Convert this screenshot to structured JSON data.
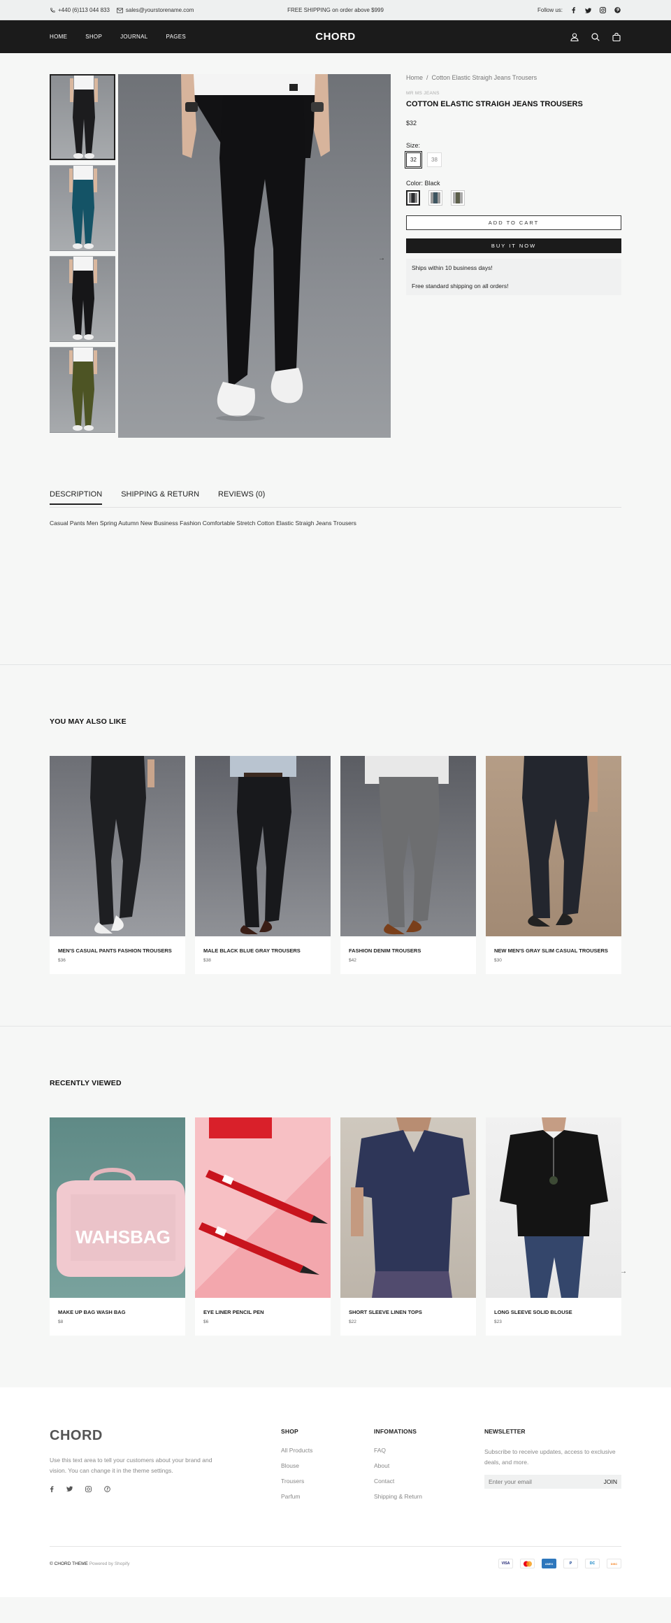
{
  "topbar": {
    "phone": "+440 (6)113 044 833",
    "email": "sales@yourstorename.com",
    "promo": "FREE SHIPPING on order above $999",
    "follow_label": "Follow us:"
  },
  "header": {
    "nav": [
      "HOME",
      "SHOP",
      "JOURNAL",
      "PAGES"
    ],
    "logo": "CHORD"
  },
  "product": {
    "breadcrumb_home": "Home",
    "breadcrumb_sep": "/",
    "breadcrumb_current": "Cotton Elastic Straigh Jeans Trousers",
    "vendor": "MR MS JEANS",
    "title": "COTTON ELASTIC STRAIGH JEANS TROUSERS",
    "price": "$32",
    "size_label": "Size:",
    "sizes": [
      "32",
      "38"
    ],
    "color_label": "Color: Black",
    "colors": [
      "#2a2b2e",
      "#3d5560",
      "#5c5f4a"
    ],
    "add_to_cart": "ADD TO CART",
    "buy_now": "BUY IT NOW",
    "notice_1": "Ships within 10 business days!",
    "notice_2": "Free standard shipping on all orders!",
    "thumb_colors": [
      "#1c1c1e",
      "#145366",
      "#161618",
      "#4d5424"
    ]
  },
  "tabs": {
    "items": [
      "DESCRIPTION",
      "SHIPPING & RETURN",
      "REVIEWS (0)"
    ],
    "description": "Casual Pants Men Spring Autumn New Business Fashion Comfortable Stretch Cotton Elastic Straigh Jeans Trousers"
  },
  "also_like": {
    "title": "YOU MAY ALSO LIKE",
    "items": [
      {
        "name": "MEN'S CASUAL PANTS FASHION TROUSERS",
        "price": "$36"
      },
      {
        "name": "MALE BLACK BLUE GRAY TROUSERS",
        "price": "$38"
      },
      {
        "name": "FASHION DENIM TROUSERS",
        "price": "$42"
      },
      {
        "name": "NEW MEN'S GRAY SLIM CASUAL TROUSERS",
        "price": "$30"
      }
    ]
  },
  "recent": {
    "title": "RECENTLY VIEWED",
    "bag_text": "WAHSBAG",
    "items": [
      {
        "name": "MAKE UP BAG WASH BAG",
        "price": "$8"
      },
      {
        "name": "EYE LINER PENCIL PEN",
        "price": "$6"
      },
      {
        "name": "SHORT SLEEVE LINEN TOPS",
        "price": "$22"
      },
      {
        "name": "LONG SLEEVE SOLID BLOUSE",
        "price": "$23"
      }
    ]
  },
  "footer": {
    "logo": "CHORD",
    "about": "Use this text area to tell your customers about your brand and vision. You can change it in the theme settings.",
    "shop_title": "SHOP",
    "shop_links": [
      "All Products",
      "Blouse",
      "Trousers",
      "Parfum"
    ],
    "info_title": "INFOMATIONS",
    "info_links": [
      "FAQ",
      "About",
      "Contact",
      "Shipping & Return"
    ],
    "news_title": "NEWSLETTER",
    "news_text": "Subscribe to receive updates, access to exclusive deals, and more.",
    "news_placeholder": "Enter your email",
    "news_button": "JOIN",
    "copyright": "© CHORD THEME",
    "powered": "Powered by Shopify",
    "payments": [
      "VISA",
      "MC",
      "AMEX",
      "P",
      "DC",
      "DISC"
    ]
  }
}
